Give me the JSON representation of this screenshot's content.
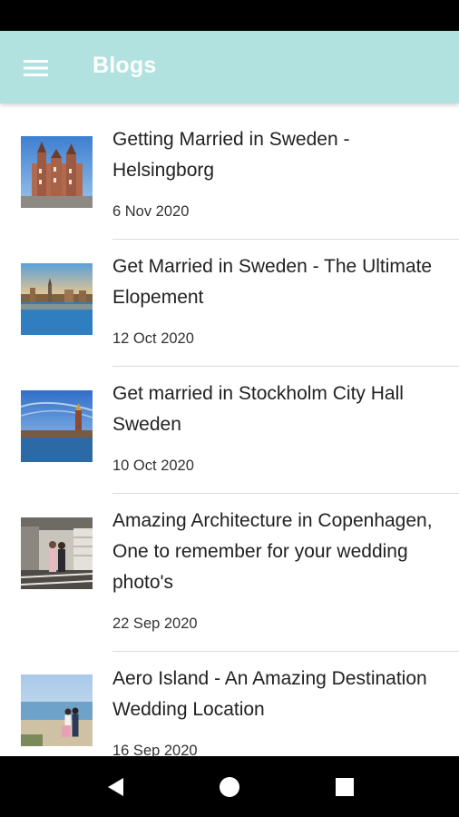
{
  "app_bar": {
    "title": "Blogs",
    "menu_icon": "hamburger-menu-icon",
    "color": "#b2e2e0"
  },
  "blogs": [
    {
      "title": "Getting Married in Sweden - Helsingborg",
      "date": "6 Nov 2020",
      "image": "castle-photo"
    },
    {
      "title": "Get Married in Sweden - The Ultimate Elopement",
      "date": "12 Oct 2020",
      "image": "city-waterfront-photo"
    },
    {
      "title": "Get married in Stockholm City Hall Sweden",
      "date": "10 Oct 2020",
      "image": "city-hall-photo"
    },
    {
      "title": "Amazing Architecture in Copenhagen, One to remember for your wedding photo's",
      "date": "22 Sep 2020",
      "image": "couple-architecture-photo"
    },
    {
      "title": "Aero Island - An Amazing Destination Wedding Location",
      "date": "16 Sep 2020",
      "image": "couple-beach-photo"
    }
  ],
  "nav_bar": {
    "back_icon": "back-triangle-icon",
    "home_icon": "home-circle-icon",
    "recents_icon": "recents-square-icon"
  }
}
